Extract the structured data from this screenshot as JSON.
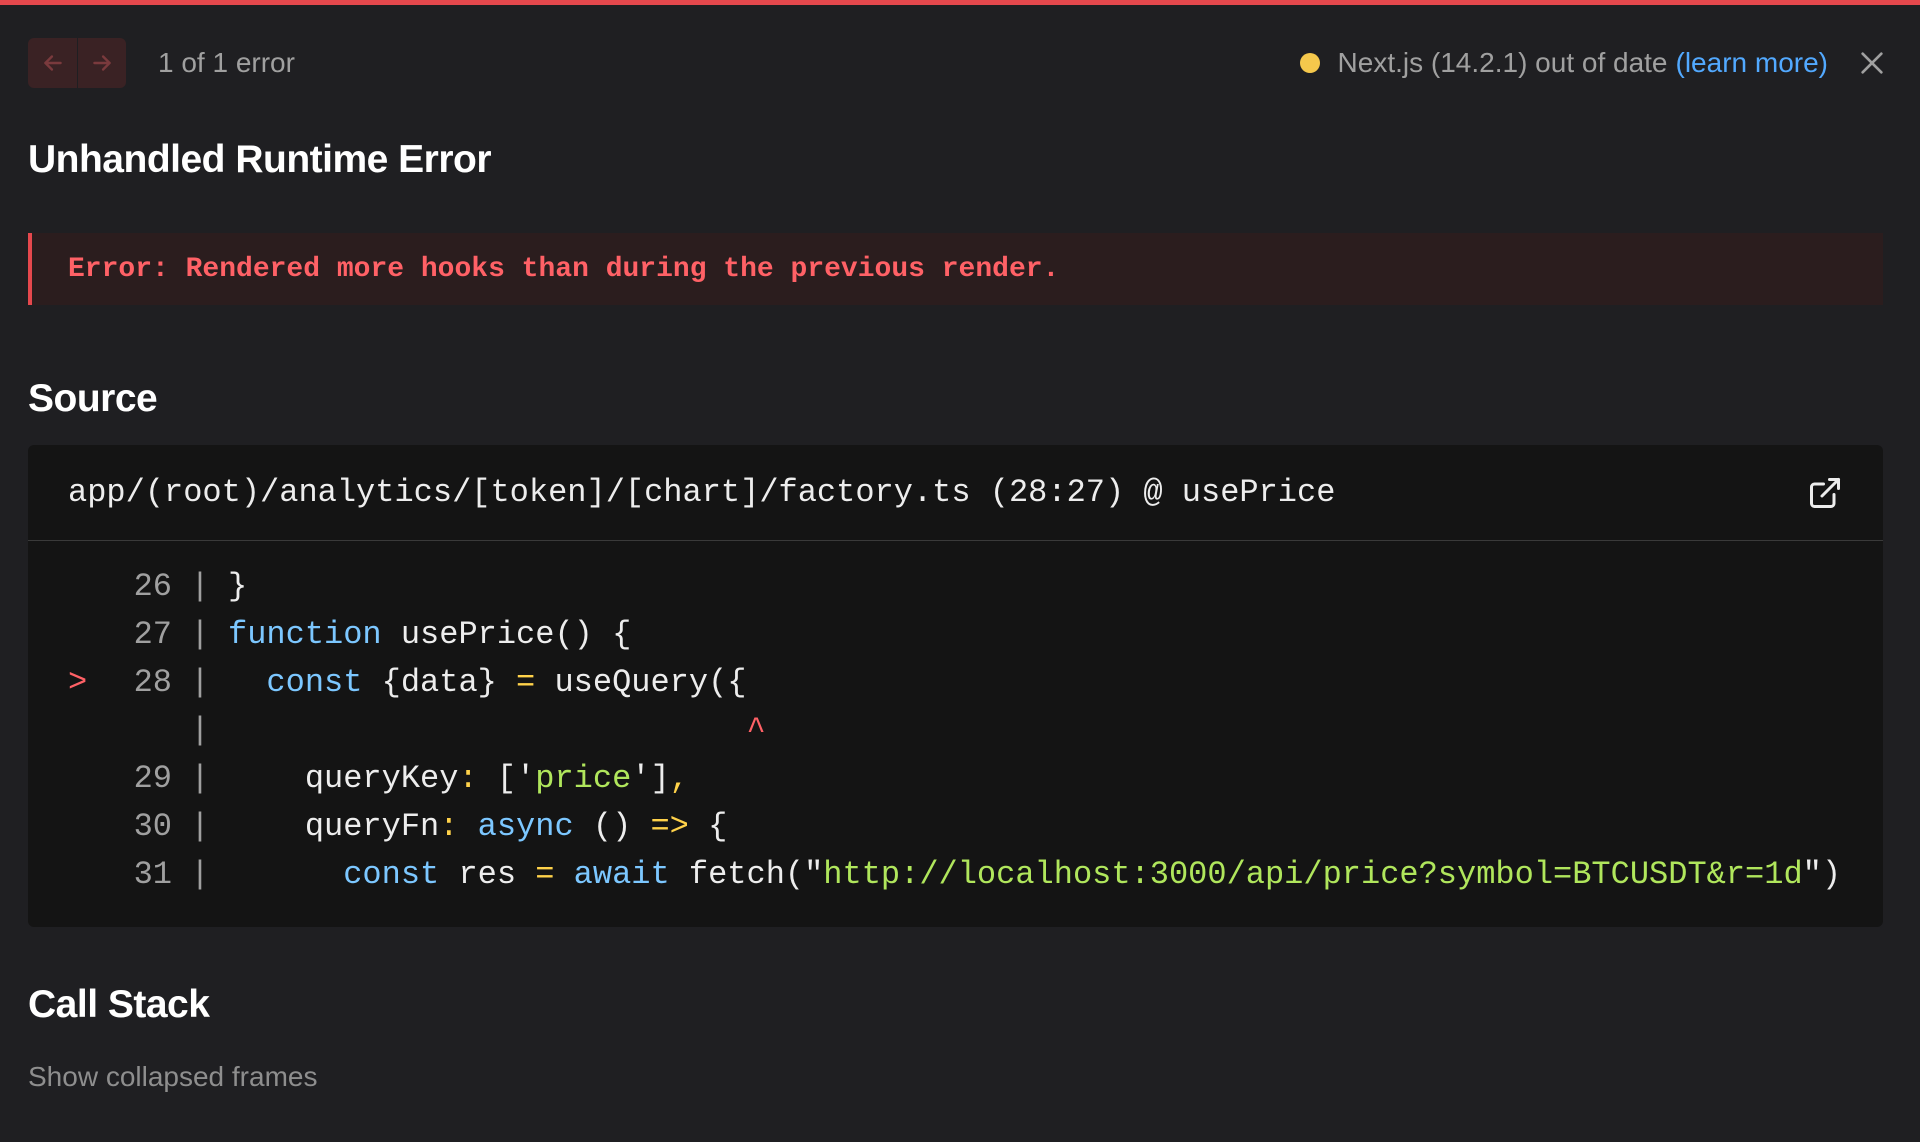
{
  "colors": {
    "accent_red": "#e5484d",
    "warning_dot": "#f5c84c",
    "link_blue": "#52a9ff",
    "background": "#1f1f22"
  },
  "header": {
    "prev_icon": "arrow-left-icon",
    "next_icon": "arrow-right-icon",
    "error_count": "1 of 1 error",
    "version_text": "Next.js (14.2.1) out of date",
    "learn_more": "(learn more)",
    "close_icon": "close-icon"
  },
  "title": "Unhandled Runtime Error",
  "error_message": "Error: Rendered more hooks than during the previous render.",
  "source": {
    "heading": "Source",
    "file_path": "app/(root)/analytics/[token]/[chart]/factory.ts (28:27) @ usePrice",
    "open_icon": "external-link-icon",
    "lines": [
      {
        "marker": "",
        "number": "26",
        "pipe": "|",
        "code": "}"
      },
      {
        "marker": "",
        "number": "27",
        "pipe": "|",
        "code": "function usePrice() {"
      },
      {
        "marker": ">",
        "number": "28",
        "pipe": "|",
        "code": "  const {data} = useQuery({"
      },
      {
        "marker": "",
        "number": "",
        "pipe": "|",
        "code": "                           ^"
      },
      {
        "marker": "",
        "number": "29",
        "pipe": "|",
        "code": "    queryKey: ['price'],"
      },
      {
        "marker": "",
        "number": "30",
        "pipe": "|",
        "code": "    queryFn: async () => {"
      },
      {
        "marker": "",
        "number": "31",
        "pipe": "|",
        "code": "      const res = await fetch(\"http://localhost:3000/api/price?symbol=BTCUSDT&r=1d\")"
      }
    ]
  },
  "call_stack": {
    "heading": "Call Stack",
    "toggle": "Show collapsed frames"
  }
}
